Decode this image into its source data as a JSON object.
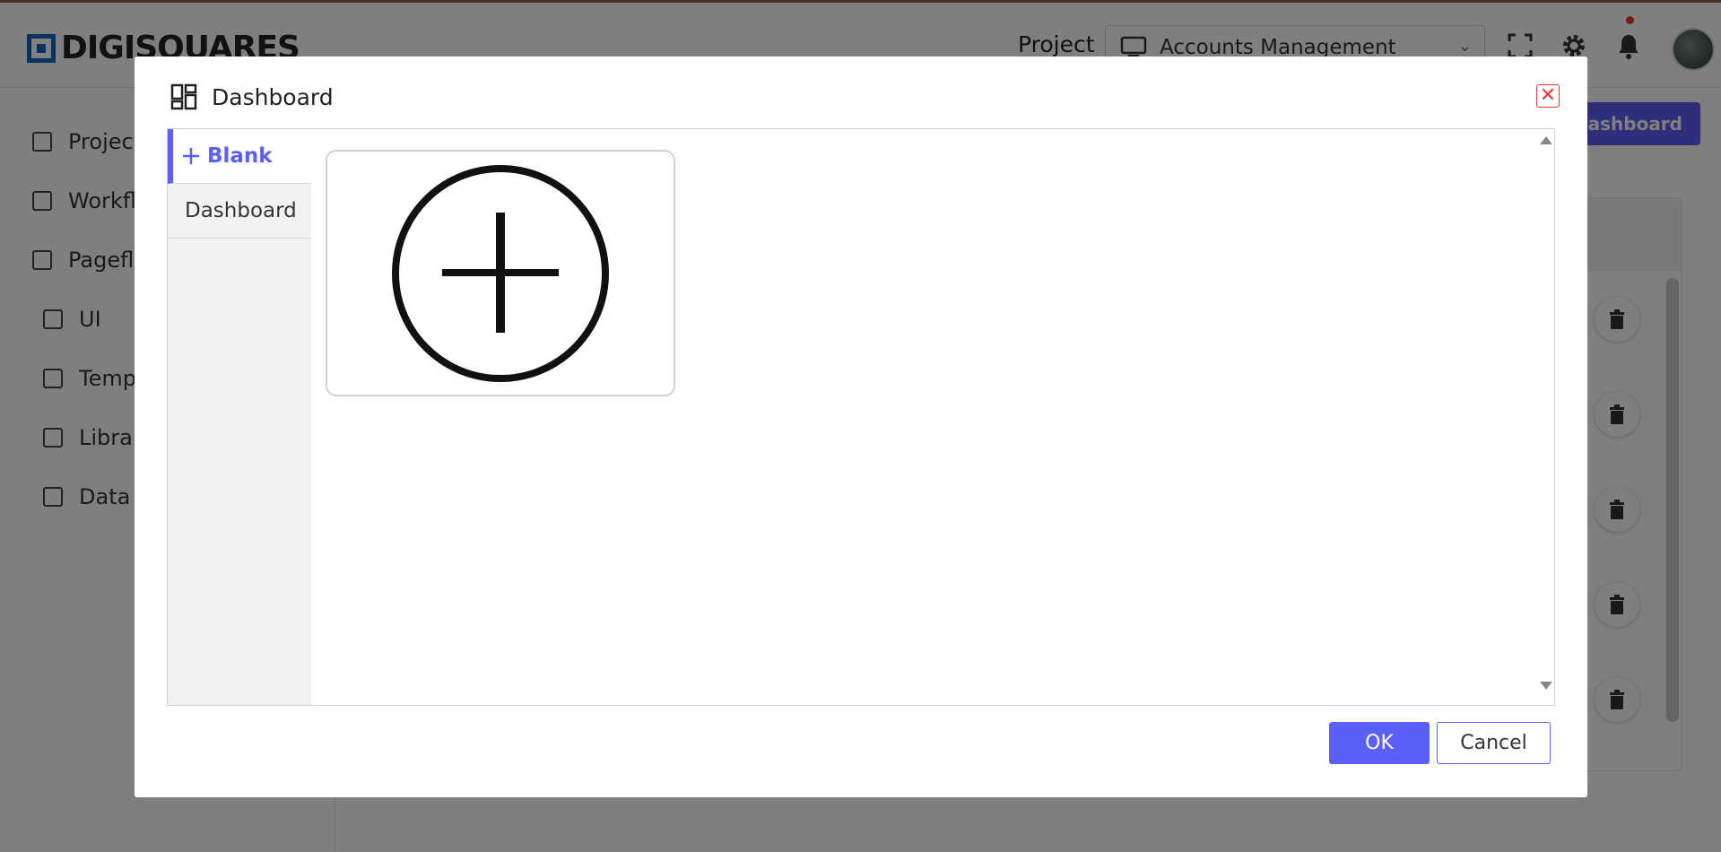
{
  "app": {
    "logo_text": "DIGISQUARES",
    "project_label": "Project",
    "project_selected": "Accounts Management"
  },
  "sidebar": {
    "items": [
      {
        "label": "Project"
      },
      {
        "label": "Workflo"
      },
      {
        "label": "Pagefl"
      },
      {
        "label": "UI"
      },
      {
        "label": "Temp"
      },
      {
        "label": "Librar"
      },
      {
        "label": "Data"
      }
    ]
  },
  "main": {
    "create_button_label": "Dashboard"
  },
  "modal": {
    "title": "Dashboard",
    "close_symbol": "✕",
    "categories": [
      {
        "label": "Blank",
        "icon": "plus-icon",
        "active": true
      },
      {
        "label": "Dashboard",
        "active": false
      }
    ],
    "tiles": [
      {
        "icon": "add-circle-icon"
      }
    ],
    "ok_label": "OK",
    "cancel_label": "Cancel"
  },
  "colors": {
    "accent": "#5b5ef7",
    "close": "#e53935",
    "brand": "#1565c0"
  }
}
